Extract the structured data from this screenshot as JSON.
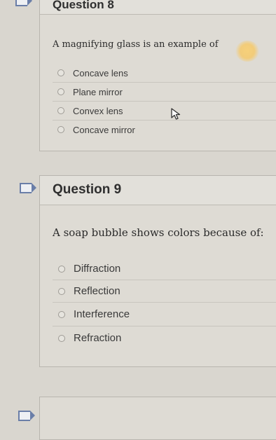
{
  "question8": {
    "title": "Question 8",
    "text": "A magnifying glass is an example of",
    "options": [
      "Concave lens",
      "Plane mirror",
      "Convex lens",
      "Concave mirror"
    ]
  },
  "question9": {
    "title": "Question 9",
    "text": "A soap bubble shows colors because of:",
    "options": [
      "Diffraction",
      "Reflection",
      "Interference",
      "Refraction"
    ]
  },
  "icons": {
    "flag": "flag-icon",
    "cursor": "mouse-pointer-icon",
    "radio": "radio-unselected"
  },
  "colors": {
    "flag_outline": "#6a7ea8",
    "background": "#d9d6cf"
  }
}
